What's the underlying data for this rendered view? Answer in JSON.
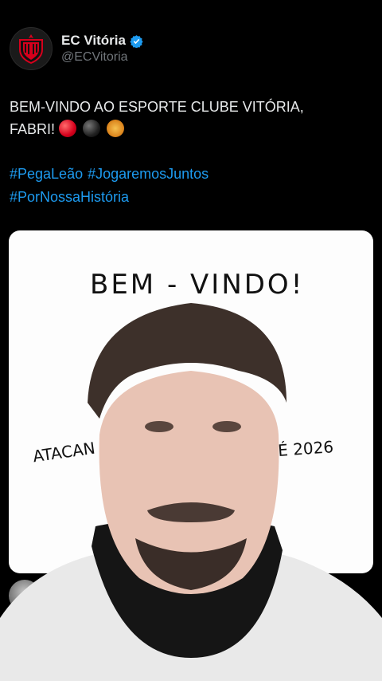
{
  "account": {
    "display_name": "EC Vitória",
    "handle": "@ECVitoria",
    "verified_icon": "verified-badge-icon",
    "avatar_icon": "club-crest-icon"
  },
  "tweet": {
    "line1": "BEM-VINDO AO ESPORTE CLUBE VITÓRIA,",
    "line2": "FABRI!",
    "emojis": [
      "red-circle",
      "black-circle",
      "lion-face"
    ],
    "hashtags": [
      "#PegaLeão",
      "#JogaremosJuntos",
      "#PorNossaHistória"
    ]
  },
  "media": {
    "title": "BEM - VINDO!",
    "left_text": "ATACAN",
    "right_text": "TÉ 2026"
  },
  "colors": {
    "background": "#000000",
    "text": "#e7e9ea",
    "muted": "#71767b",
    "link": "#1d9bf0",
    "brand_red": "#d6001c"
  }
}
